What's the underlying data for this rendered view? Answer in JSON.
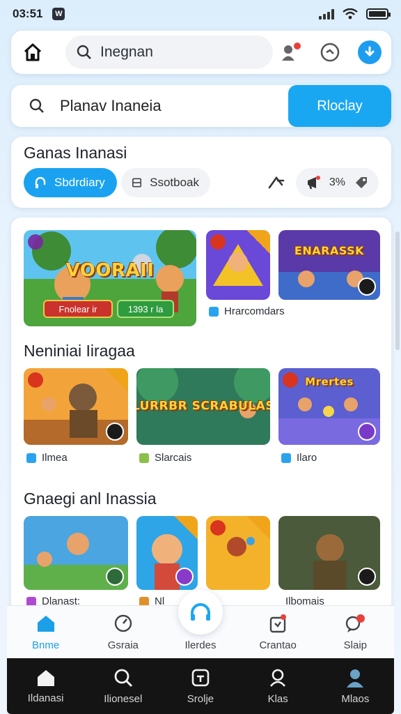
{
  "status": {
    "time": "03:51",
    "badge": "W"
  },
  "topbar": {
    "search_text": "Inegnan"
  },
  "search2": {
    "text": "Planav Inaneia",
    "button": "Rloclay"
  },
  "filters": {
    "title": "Ganas Inanasi",
    "chip_active": "Sbdrdiary",
    "chip_plain": "Ssotboak",
    "counter": "3%"
  },
  "row1": {
    "hero_title": "VOORAII",
    "hero_btn_red": "Fnolear ir",
    "hero_btn_green": "1393 r la",
    "tile3_title": "ENARASSK",
    "caption": "Hrarcomdars"
  },
  "section2": {
    "title": "Neniniai Iiragaa",
    "tile2_title": "LURRBR SCRABULAS",
    "tile3_title": "Mrertes",
    "captions": [
      "Ilmea",
      "Slarcais",
      "Ilaro"
    ]
  },
  "section3": {
    "title": "Gnaegi anl Inassia",
    "captions": [
      "Dlanast:",
      "Nl",
      "Ilbomais"
    ]
  },
  "tabs": [
    {
      "label": "Bnme",
      "icon": "home-icon"
    },
    {
      "label": "Gsraia",
      "icon": "gauge-icon"
    },
    {
      "label": "Ilerdes",
      "icon": "headset-icon"
    },
    {
      "label": "Crantao",
      "icon": "gift-icon"
    },
    {
      "label": "Slaip",
      "icon": "chat-icon"
    }
  ],
  "navbar": [
    {
      "label": "Ildanasi",
      "icon": "home-icon"
    },
    {
      "label": "Ilionesel",
      "icon": "search-icon"
    },
    {
      "label": "Srolje",
      "icon": "controller-icon"
    },
    {
      "label": "Klas",
      "icon": "person-search-icon"
    },
    {
      "label": "Mlaos",
      "icon": "profile-icon"
    }
  ],
  "colors": {
    "accent": "#1aa7f2",
    "alert": "#e8413b",
    "nav_bg": "#141414"
  }
}
